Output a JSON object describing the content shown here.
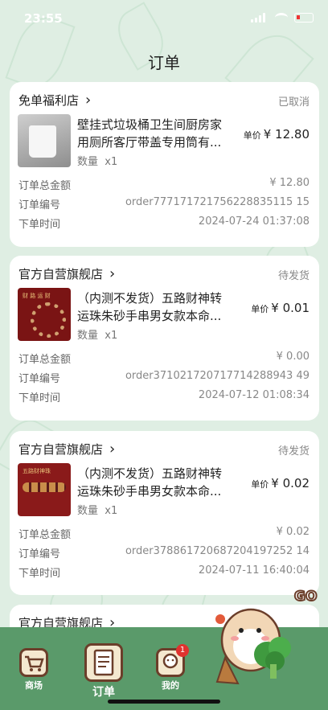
{
  "status": {
    "time": "23:55"
  },
  "page_title": "订单",
  "labels": {
    "unit_price": "单价",
    "quantity": "数量",
    "total": "订单总金额",
    "order_no": "订单编号",
    "time": "下单时间"
  },
  "orders": [
    {
      "shop": "免单福利店",
      "status": "已取消",
      "product_name": "壁挂式垃圾桶卫生间厨房家用厕所客厅带盖专用筒有...",
      "qty": "x1",
      "price": "¥ 12.80",
      "total": "¥ 12.80",
      "order_no": "order777171721756228835115 15",
      "time": "2024-07-24 01:37:08"
    },
    {
      "shop": "官方自营旗舰店",
      "status": "待发货",
      "product_name": "（内测不发货）五路财神转运珠朱砂手串男女款本命...",
      "qty": "x1",
      "price": "¥ 0.01",
      "total": "¥ 0.00",
      "order_no": "order371021720717714288943 49",
      "time": "2024-07-12 01:08:34",
      "thumb_text": "财 路 运 财"
    },
    {
      "shop": "官方自营旗舰店",
      "status": "待发货",
      "product_name": "（内测不发货）五路财神转运珠朱砂手串男女款本命...",
      "qty": "x1",
      "price": "¥ 0.02",
      "total": "¥ 0.02",
      "order_no": "order378861720687204197252 14",
      "time": "2024-07-11 16:40:04",
      "thumb_text": "五路财神珠"
    },
    {
      "shop": "官方自营旗舰店"
    }
  ],
  "tabs": [
    {
      "label": "商场",
      "icon": "cart-icon"
    },
    {
      "label": "订单",
      "icon": "clipboard-icon"
    },
    {
      "label": "我的",
      "icon": "avatar-icon",
      "badge": "1"
    }
  ],
  "mascot": {
    "text": "GO"
  }
}
